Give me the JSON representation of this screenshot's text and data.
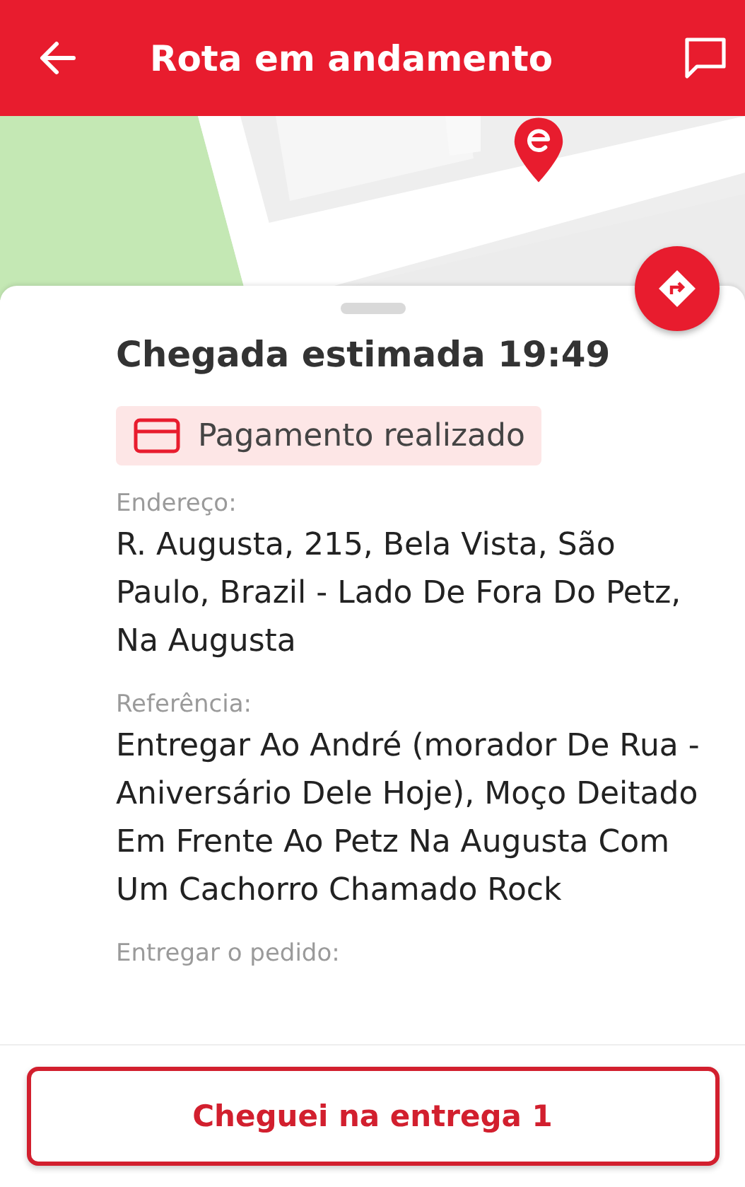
{
  "header": {
    "title": "Rota em andamento"
  },
  "sheet": {
    "eta": "Chegada estimada 19:49",
    "payment": {
      "label": "Pagamento realizado"
    },
    "fields": [
      {
        "label": "Endereço:",
        "value": "R. Augusta, 215, Bela Vista, São Paulo, Brazil - Lado De Fora Do Petz, Na Augusta"
      },
      {
        "label": "Referência:",
        "value": "Entregar Ao André (morador De Rua - Aniversário Dele Hoje), Moço Deitado Em Frente Ao Petz Na Augusta  Com Um Cachorro Chamado Rock"
      },
      {
        "label": "Entregar o pedido:"
      }
    ]
  },
  "action": {
    "label": "Cheguei na entrega 1"
  }
}
